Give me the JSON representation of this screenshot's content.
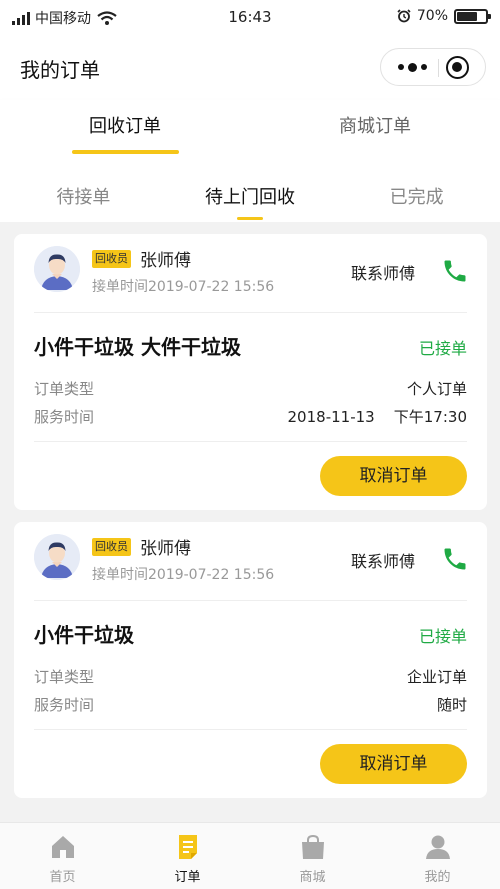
{
  "status_bar": {
    "carrier": "中国移动",
    "time": "16:43",
    "battery": "70%",
    "battery_level": 0.7
  },
  "nav": {
    "title": "我的订单"
  },
  "main_tabs": [
    {
      "label": "回收订单",
      "active": true
    },
    {
      "label": "商城订单",
      "active": false
    }
  ],
  "sub_tabs": [
    {
      "label": "待接单",
      "active": false
    },
    {
      "label": "待上门回收",
      "active": true
    },
    {
      "label": "已完成",
      "active": false
    }
  ],
  "orders": [
    {
      "role_badge": "回收员",
      "worker_name": "张师傅",
      "accept_time": "接单时间2019-07-22  15:56",
      "contact_label": "联系师傅",
      "garbage_type": "小件干垃圾  大件干垃圾",
      "status": "已接单",
      "type_label": "订单类型",
      "type_value": "个人订单",
      "service_label": "服务时间",
      "service_value": "2018-11-13    下午17:30",
      "cancel_label": "取消订单"
    },
    {
      "role_badge": "回收员",
      "worker_name": "张师傅",
      "accept_time": "接单时间2019-07-22  15:56",
      "contact_label": "联系师傅",
      "garbage_type": "小件干垃圾",
      "status": "已接单",
      "type_label": "订单类型",
      "type_value": "企业订单",
      "service_label": "服务时间",
      "service_value": "随时",
      "cancel_label": "取消订单"
    }
  ],
  "tab_bar": [
    {
      "label": "首页",
      "icon": "home-icon",
      "active": false
    },
    {
      "label": "订单",
      "icon": "order-icon",
      "active": true
    },
    {
      "label": "商城",
      "icon": "shopping-bag-icon",
      "active": false
    },
    {
      "label": "我的",
      "icon": "user-icon",
      "active": false
    }
  ],
  "colors": {
    "accent": "#f5c518",
    "status_green": "#1faa44",
    "inactive_icon": "#a9a9a9"
  }
}
